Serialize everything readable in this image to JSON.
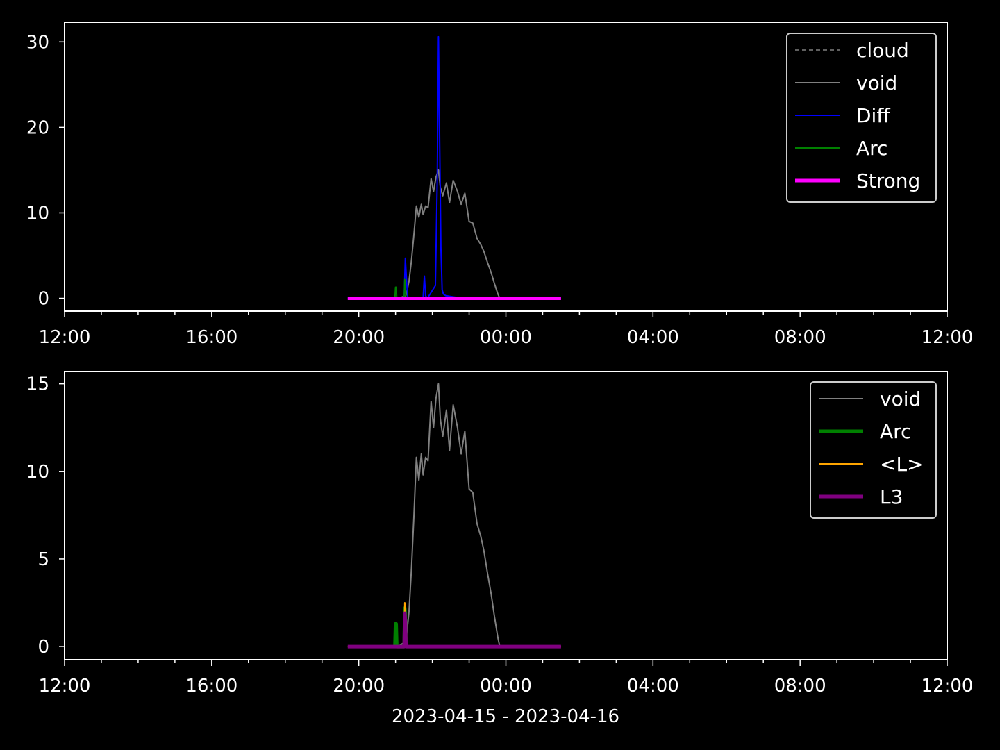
{
  "figure": {
    "background": "#000000",
    "foreground": "#ffffff",
    "xlabel": "2023-04-15 - 2023-04-16"
  },
  "chart_data": [
    {
      "type": "line",
      "title": "",
      "xlabel": "",
      "ylabel": "",
      "x_unit": "hours since 2023-04-15 12:00",
      "xlim": [
        "2023-04-15 12:00",
        "2023-04-16 12:00"
      ],
      "ylim": [
        -1.5,
        32.3
      ],
      "x_tick_labels": [
        "12:00",
        "16:00",
        "20:00",
        "00:00",
        "04:00",
        "08:00",
        "12:00"
      ],
      "y_tick_labels": [
        "0",
        "10",
        "20",
        "30"
      ],
      "y_ticks": [
        0,
        10,
        20,
        30
      ],
      "grid": false,
      "legend_position": "top-right",
      "series": [
        {
          "name": "cloud",
          "color": "#808080",
          "style": "dashed",
          "width": 1.5,
          "x": [],
          "y": []
        },
        {
          "name": "void",
          "color": "#808080",
          "style": "solid",
          "width": 2,
          "x": [
            "2023-04-15 21:04",
            "2023-04-15 21:17",
            "2023-04-15 21:22",
            "2023-04-15 21:26",
            "2023-04-15 21:30",
            "2023-04-15 21:34",
            "2023-04-15 21:38",
            "2023-04-15 21:42",
            "2023-04-15 21:45",
            "2023-04-15 21:49",
            "2023-04-15 21:53",
            "2023-04-15 21:58",
            "2023-04-15 22:02",
            "2023-04-15 22:06",
            "2023-04-15 22:10",
            "2023-04-15 22:13",
            "2023-04-15 22:17",
            "2023-04-15 22:23",
            "2023-04-15 22:28",
            "2023-04-15 22:34",
            "2023-04-15 22:41",
            "2023-04-15 22:47",
            "2023-04-15 22:53",
            "2023-04-15 23:00",
            "2023-04-15 23:06",
            "2023-04-15 23:13",
            "2023-04-15 23:19",
            "2023-04-15 23:24",
            "2023-04-15 23:30",
            "2023-04-15 23:36",
            "2023-04-15 23:41",
            "2023-04-15 23:47",
            "2023-04-15 23:50"
          ],
          "y": [
            0,
            0.3,
            2.0,
            4.5,
            7.5,
            10.8,
            9.5,
            11.0,
            9.8,
            10.8,
            10.6,
            14.0,
            12.5,
            14.2,
            15.0,
            13.0,
            12.0,
            13.5,
            11.2,
            13.8,
            12.5,
            11.0,
            12.3,
            9.0,
            8.8,
            7.0,
            6.3,
            5.5,
            4.2,
            3.0,
            1.8,
            0.5,
            0
          ]
        },
        {
          "name": "Diff",
          "color": "#0000ff",
          "style": "solid",
          "width": 2,
          "x": [
            "2023-04-15 19:42",
            "2023-04-15 21:14",
            "2023-04-15 21:16",
            "2023-04-15 21:18",
            "2023-04-15 21:20",
            "2023-04-15 21:45",
            "2023-04-15 21:47",
            "2023-04-15 21:49",
            "2023-04-15 21:52",
            "2023-04-15 22:05",
            "2023-04-15 22:08",
            "2023-04-15 22:10",
            "2023-04-15 22:12",
            "2023-04-15 22:14",
            "2023-04-15 22:16",
            "2023-04-15 22:18",
            "2023-04-15 22:22",
            "2023-04-15 22:40",
            "2023-04-15 23:00",
            "2023-04-16 01:30"
          ],
          "y": [
            0,
            0,
            4.7,
            2.0,
            0,
            0,
            2.6,
            0.3,
            0,
            1.5,
            13.5,
            30.6,
            18.0,
            6.0,
            1.0,
            0.5,
            0.3,
            0.1,
            0,
            0
          ]
        },
        {
          "name": "Arc",
          "color": "#008000",
          "style": "solid",
          "width": 2,
          "x": [
            "2023-04-15 20:59",
            "2023-04-15 21:00",
            "2023-04-15 21:01",
            "2023-04-15 21:02",
            "2023-04-15 21:14",
            "2023-04-15 21:15",
            "2023-04-15 21:16",
            "2023-04-15 21:17"
          ],
          "y": [
            0,
            1.3,
            1.3,
            0,
            0,
            2.2,
            1.9,
            0
          ]
        },
        {
          "name": "Strong",
          "color": "#ff00ff",
          "style": "solid",
          "width": 5,
          "x": [
            "2023-04-15 19:42",
            "2023-04-16 01:30"
          ],
          "y": [
            0,
            0
          ]
        }
      ],
      "legend": [
        "cloud",
        "void",
        "Diff",
        "Arc",
        "Strong"
      ]
    },
    {
      "type": "line",
      "title": "",
      "xlabel": "2023-04-15 - 2023-04-16",
      "ylabel": "",
      "x_unit": "hours since 2023-04-15 12:00",
      "xlim": [
        "2023-04-15 12:00",
        "2023-04-16 12:00"
      ],
      "ylim": [
        -0.75,
        15.7
      ],
      "x_tick_labels": [
        "12:00",
        "16:00",
        "20:00",
        "00:00",
        "04:00",
        "08:00",
        "12:00"
      ],
      "y_tick_labels": [
        "0",
        "5",
        "10",
        "15"
      ],
      "y_ticks": [
        0,
        5,
        10,
        15
      ],
      "grid": false,
      "legend_position": "top-right",
      "series": [
        {
          "name": "void",
          "color": "#808080",
          "style": "solid",
          "width": 2,
          "x": [
            "2023-04-15 21:04",
            "2023-04-15 21:17",
            "2023-04-15 21:22",
            "2023-04-15 21:26",
            "2023-04-15 21:30",
            "2023-04-15 21:34",
            "2023-04-15 21:38",
            "2023-04-15 21:42",
            "2023-04-15 21:45",
            "2023-04-15 21:49",
            "2023-04-15 21:53",
            "2023-04-15 21:58",
            "2023-04-15 22:02",
            "2023-04-15 22:06",
            "2023-04-15 22:10",
            "2023-04-15 22:13",
            "2023-04-15 22:17",
            "2023-04-15 22:23",
            "2023-04-15 22:28",
            "2023-04-15 22:34",
            "2023-04-15 22:41",
            "2023-04-15 22:47",
            "2023-04-15 22:53",
            "2023-04-15 23:00",
            "2023-04-15 23:06",
            "2023-04-15 23:13",
            "2023-04-15 23:19",
            "2023-04-15 23:24",
            "2023-04-15 23:30",
            "2023-04-15 23:36",
            "2023-04-15 23:41",
            "2023-04-15 23:47",
            "2023-04-15 23:50"
          ],
          "y": [
            0,
            0.3,
            2.0,
            4.5,
            7.5,
            10.8,
            9.5,
            11.0,
            9.8,
            10.8,
            10.6,
            14.0,
            12.5,
            14.2,
            15.0,
            13.0,
            12.0,
            13.5,
            11.2,
            13.8,
            12.5,
            11.0,
            12.3,
            9.0,
            8.8,
            7.0,
            6.3,
            5.5,
            4.2,
            3.0,
            1.8,
            0.5,
            0
          ]
        },
        {
          "name": "Arc",
          "color": "#008000",
          "style": "solid",
          "width": 5,
          "x": [
            "2023-04-15 20:59",
            "2023-04-15 21:00",
            "2023-04-15 21:01",
            "2023-04-15 21:02",
            "2023-04-15 21:14",
            "2023-04-15 21:15",
            "2023-04-15 21:16",
            "2023-04-15 21:17"
          ],
          "y": [
            0,
            1.3,
            1.3,
            0,
            0,
            2.2,
            1.9,
            0
          ]
        },
        {
          "name": "<L>",
          "color": "#ffa500",
          "style": "solid",
          "width": 2,
          "x": [
            "2023-04-15 19:42",
            "2023-04-15 21:14",
            "2023-04-15 21:15",
            "2023-04-15 21:16",
            "2023-04-15 21:17",
            "2023-04-16 01:30"
          ],
          "y": [
            0,
            0,
            2.5,
            2.0,
            0,
            0
          ]
        },
        {
          "name": "L3",
          "color": "#800080",
          "style": "solid",
          "width": 5,
          "x": [
            "2023-04-15 19:42",
            "2023-04-15 21:14",
            "2023-04-15 21:15",
            "2023-04-15 21:16",
            "2023-04-15 21:17",
            "2023-04-16 01:30"
          ],
          "y": [
            0,
            0,
            1.9,
            1.5,
            0,
            0
          ]
        }
      ],
      "legend": [
        "void",
        "Arc",
        "<L>",
        "L3"
      ]
    }
  ]
}
